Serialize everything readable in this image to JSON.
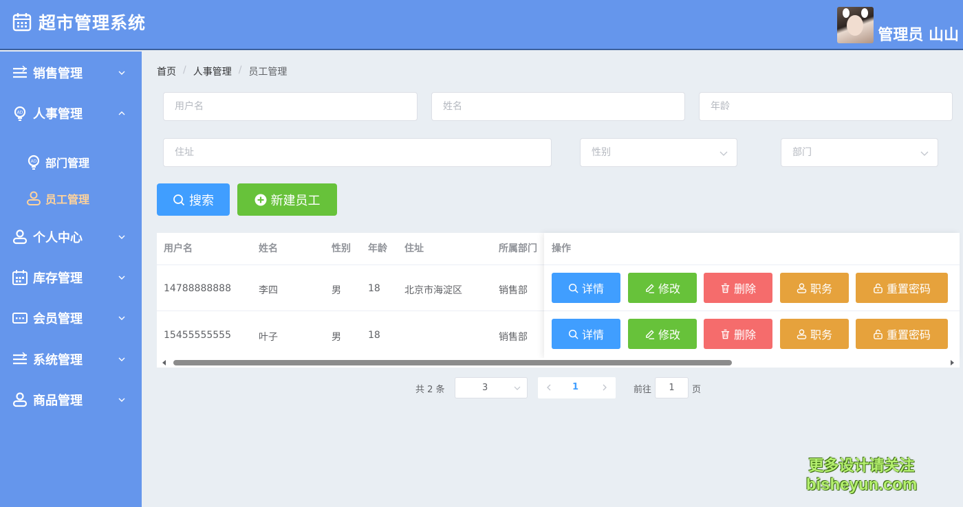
{
  "app": {
    "title": "超市管理系统",
    "user_name": "管理员 山山"
  },
  "sidebar": {
    "items": [
      {
        "label": "销售管理",
        "icon": "list-icon",
        "expanded": false
      },
      {
        "label": "人事管理",
        "icon": "lightbulb-icon",
        "expanded": true
      },
      {
        "label": "个人中心",
        "icon": "user-icon",
        "expanded": false
      },
      {
        "label": "库存管理",
        "icon": "calendar-icon",
        "expanded": false
      },
      {
        "label": "会员管理",
        "icon": "card-icon",
        "expanded": false
      },
      {
        "label": "系统管理",
        "icon": "list-icon",
        "expanded": false
      },
      {
        "label": "商品管理",
        "icon": "user-icon",
        "expanded": false
      }
    ],
    "sub_items": [
      {
        "label": "部门管理",
        "icon": "lightbulb-icon",
        "active": false
      },
      {
        "label": "员工管理",
        "icon": "user-icon",
        "active": true
      }
    ]
  },
  "breadcrumb": [
    "首页",
    "人事管理",
    "员工管理"
  ],
  "filters": {
    "username_placeholder": "用户名",
    "name_placeholder": "姓名",
    "age_placeholder": "年龄",
    "address_placeholder": "住址",
    "gender_placeholder": "性别",
    "department_placeholder": "部门"
  },
  "buttons": {
    "search": "搜索",
    "create": "新建员工"
  },
  "table": {
    "columns": [
      "用户名",
      "姓名",
      "性别",
      "年龄",
      "住址",
      "所属部门",
      "操作"
    ],
    "rows": [
      {
        "username": "14788888888",
        "name": "李四",
        "gender": "男",
        "age": "18",
        "address": "北京市海淀区",
        "department": "销售部"
      },
      {
        "username": "15455555555",
        "name": "叶子",
        "gender": "男",
        "age": "18",
        "address": "",
        "department": "销售部"
      }
    ],
    "actions": [
      "详情",
      "修改",
      "删除",
      "职务",
      "重置密码"
    ]
  },
  "pagination": {
    "total": "共 2 条",
    "page_size": "3",
    "current_page": "1",
    "goto_label": "前往",
    "goto_value": "1",
    "goto_suffix": "页"
  },
  "watermark": {
    "line1": "更多设计请关注",
    "line2": "bisheyun.com"
  },
  "colors": {
    "primary_bg": "#6596ec",
    "blue": "#409eff",
    "green": "#67c23a",
    "red": "#f56c6c",
    "orange": "#e6a23c",
    "active_menu": "#ffd39b"
  }
}
